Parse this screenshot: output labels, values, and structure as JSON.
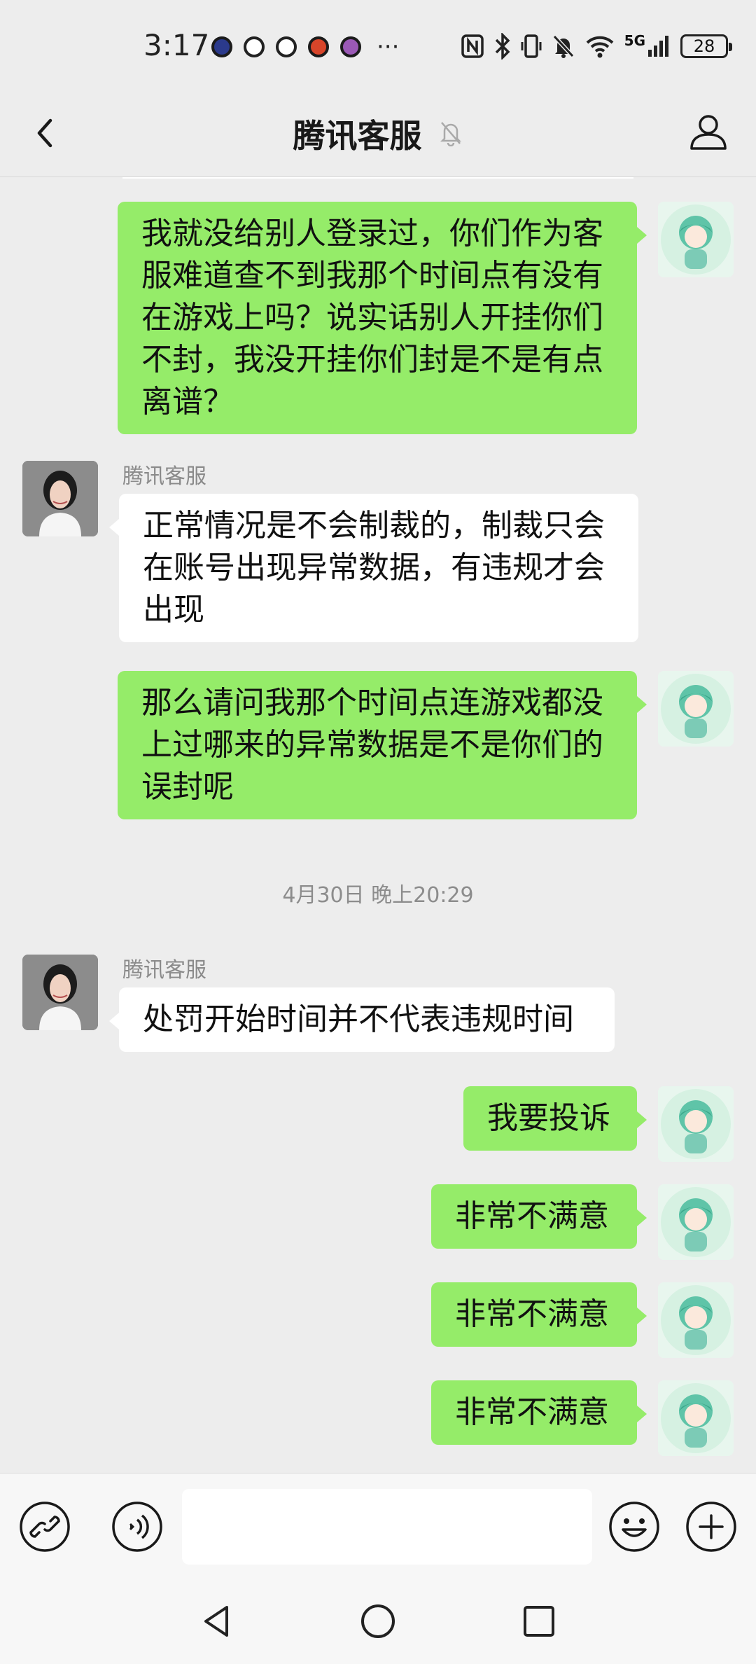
{
  "status_bar": {
    "time": "3:17",
    "more": "···",
    "network": "5G",
    "battery": "28",
    "icons": [
      "game-app-icon",
      "app-icon",
      "app-icon",
      "app-icon",
      "app-icon",
      "nfc-icon",
      "bluetooth-icon",
      "vibrate-icon",
      "mute-icon",
      "wifi-icon",
      "signal-icon",
      "battery-icon"
    ]
  },
  "header": {
    "title": "腾讯客服",
    "icons": [
      "back-arrow-icon",
      "mute-bell-icon",
      "profile-icon"
    ]
  },
  "messages": [
    {
      "from": "me",
      "text": "我就没给别人登录过，你们作为客服难道查不到我那个时间点有没有在游戏上吗？说实话别人开挂你们不封，我没开挂你们封是不是有点离谱？"
    },
    {
      "from": "them",
      "sender": "腾讯客服",
      "text": "正常情况是不会制裁的，制裁只会在账号出现异常数据，有违规才会出现"
    },
    {
      "from": "me",
      "text": "那么请问我那个时间点连游戏都没上过哪来的异常数据是不是你们的误封呢"
    },
    {
      "from": "them",
      "sender": "腾讯客服",
      "text": "处罚开始时间并不代表违规时间"
    },
    {
      "from": "me",
      "text": "我要投诉"
    },
    {
      "from": "me",
      "text": "非常不满意"
    },
    {
      "from": "me",
      "text": "非常不满意"
    },
    {
      "from": "me",
      "text": "非常不满意"
    }
  ],
  "timestamp": "4月30日 晚上20:29",
  "input_bar": {
    "value": "",
    "icons": [
      "link-icon",
      "voice-icon",
      "emoji-icon",
      "plus-icon"
    ]
  },
  "system_nav": {
    "icons": [
      "nav-back-icon",
      "nav-home-icon",
      "nav-recents-icon"
    ]
  },
  "colors": {
    "background": "#ededed",
    "my_bubble": "#95ec69",
    "their_bubble": "#ffffff",
    "muted_text": "#8a8a8a"
  }
}
